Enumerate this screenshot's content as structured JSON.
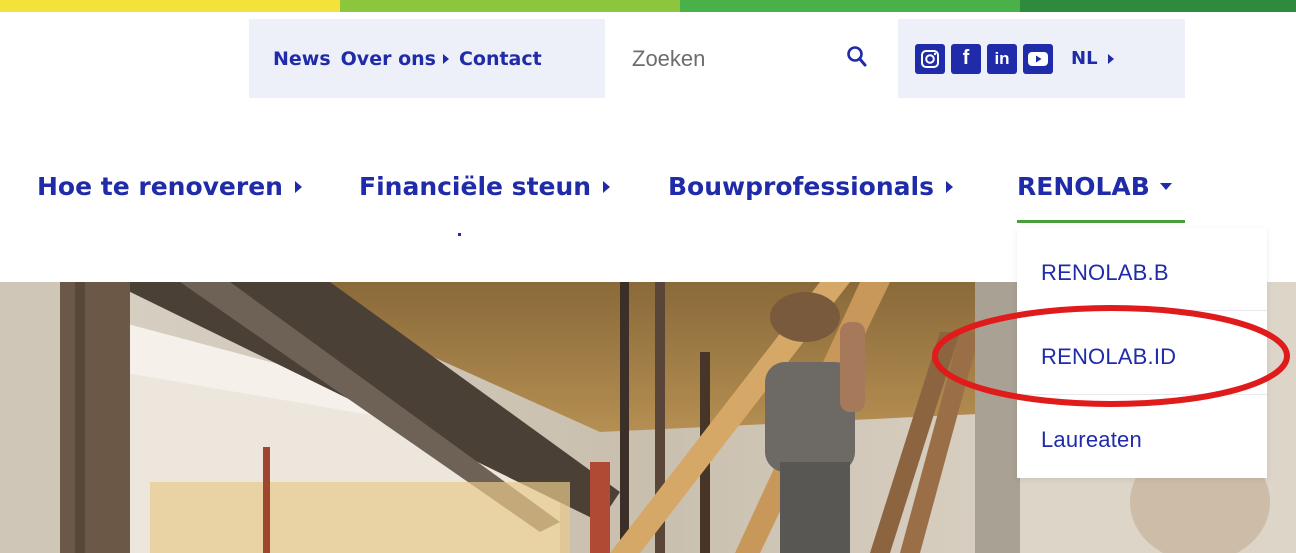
{
  "utility": {
    "links": [
      {
        "label": "News",
        "has_arrow": false
      },
      {
        "label": "Over ons",
        "has_arrow": true
      },
      {
        "label": "Contact",
        "has_arrow": false
      }
    ],
    "search": {
      "placeholder": "Zoeken",
      "value": ""
    },
    "social": [
      {
        "icon": "instagram-icon"
      },
      {
        "icon": "facebook-icon",
        "glyph": "f"
      },
      {
        "icon": "linkedin-icon",
        "glyph": "in"
      },
      {
        "icon": "youtube-icon"
      }
    ],
    "language": "NL"
  },
  "nav": {
    "items": [
      {
        "label": "Hoe te renoveren"
      },
      {
        "label": "Financiële steun"
      },
      {
        "label": "Bouwprofessionals"
      },
      {
        "label": "RENOLAB",
        "active": true
      }
    ]
  },
  "dropdown": {
    "items": [
      {
        "label": "RENOLAB.B"
      },
      {
        "label": "RENOLAB.ID",
        "highlighted": true
      },
      {
        "label": "Laureaten"
      }
    ]
  },
  "colors": {
    "brand_blue": "#1f2ba8",
    "strip": [
      "#f2e23a",
      "#8cc63f",
      "#4ab04a",
      "#2e8b3e"
    ],
    "active_underline": "#4a9e3c",
    "annotation": "#e01b1b"
  }
}
